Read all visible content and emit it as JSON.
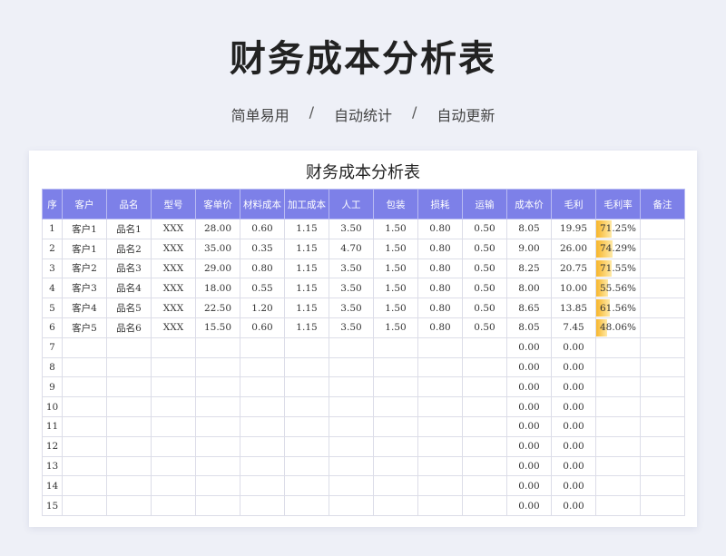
{
  "page": {
    "title": "财务成本分析表",
    "subtitle": [
      "简单易用",
      "自动统计",
      "自动更新"
    ],
    "separator": "/"
  },
  "sheet": {
    "title": "财务成本分析表",
    "header_color": "#7d80e8",
    "bar_color": "#f7b62b",
    "columns": [
      "序",
      "客户",
      "品名",
      "型号",
      "客单价",
      "材料成本",
      "加工成本",
      "人工",
      "包装",
      "损耗",
      "运输",
      "成本价",
      "毛利",
      "毛利率",
      "备注"
    ],
    "rows": [
      {
        "no": "1",
        "customer": "客户1",
        "product": "品名1",
        "model": "XXX",
        "price": "28.00",
        "material": "0.60",
        "processing": "1.15",
        "labor": "3.50",
        "packaging": "1.50",
        "loss": "0.80",
        "transport": "0.50",
        "cost": "8.05",
        "profit": "19.95",
        "rate": "71.25%",
        "rate_value": 0.7125,
        "note": ""
      },
      {
        "no": "2",
        "customer": "客户1",
        "product": "品名2",
        "model": "XXX",
        "price": "35.00",
        "material": "0.35",
        "processing": "1.15",
        "labor": "4.70",
        "packaging": "1.50",
        "loss": "0.80",
        "transport": "0.50",
        "cost": "9.00",
        "profit": "26.00",
        "rate": "74.29%",
        "rate_value": 0.7429,
        "note": ""
      },
      {
        "no": "3",
        "customer": "客户2",
        "product": "品名3",
        "model": "XXX",
        "price": "29.00",
        "material": "0.80",
        "processing": "1.15",
        "labor": "3.50",
        "packaging": "1.50",
        "loss": "0.80",
        "transport": "0.50",
        "cost": "8.25",
        "profit": "20.75",
        "rate": "71.55%",
        "rate_value": 0.7155,
        "note": ""
      },
      {
        "no": "4",
        "customer": "客户3",
        "product": "品名4",
        "model": "XXX",
        "price": "18.00",
        "material": "0.55",
        "processing": "1.15",
        "labor": "3.50",
        "packaging": "1.50",
        "loss": "0.80",
        "transport": "0.50",
        "cost": "8.00",
        "profit": "10.00",
        "rate": "55.56%",
        "rate_value": 0.5556,
        "note": ""
      },
      {
        "no": "5",
        "customer": "客户4",
        "product": "品名5",
        "model": "XXX",
        "price": "22.50",
        "material": "1.20",
        "processing": "1.15",
        "labor": "3.50",
        "packaging": "1.50",
        "loss": "0.80",
        "transport": "0.50",
        "cost": "8.65",
        "profit": "13.85",
        "rate": "61.56%",
        "rate_value": 0.6156,
        "note": ""
      },
      {
        "no": "6",
        "customer": "客户5",
        "product": "品名6",
        "model": "XXX",
        "price": "15.50",
        "material": "0.60",
        "processing": "1.15",
        "labor": "3.50",
        "packaging": "1.50",
        "loss": "0.80",
        "transport": "0.50",
        "cost": "8.05",
        "profit": "7.45",
        "rate": "48.06%",
        "rate_value": 0.4806,
        "note": ""
      },
      {
        "no": "7",
        "customer": "",
        "product": "",
        "model": "",
        "price": "",
        "material": "",
        "processing": "",
        "labor": "",
        "packaging": "",
        "loss": "",
        "transport": "",
        "cost": "0.00",
        "profit": "0.00",
        "rate": "",
        "rate_value": 0,
        "note": ""
      },
      {
        "no": "8",
        "customer": "",
        "product": "",
        "model": "",
        "price": "",
        "material": "",
        "processing": "",
        "labor": "",
        "packaging": "",
        "loss": "",
        "transport": "",
        "cost": "0.00",
        "profit": "0.00",
        "rate": "",
        "rate_value": 0,
        "note": ""
      },
      {
        "no": "9",
        "customer": "",
        "product": "",
        "model": "",
        "price": "",
        "material": "",
        "processing": "",
        "labor": "",
        "packaging": "",
        "loss": "",
        "transport": "",
        "cost": "0.00",
        "profit": "0.00",
        "rate": "",
        "rate_value": 0,
        "note": ""
      },
      {
        "no": "10",
        "customer": "",
        "product": "",
        "model": "",
        "price": "",
        "material": "",
        "processing": "",
        "labor": "",
        "packaging": "",
        "loss": "",
        "transport": "",
        "cost": "0.00",
        "profit": "0.00",
        "rate": "",
        "rate_value": 0,
        "note": ""
      },
      {
        "no": "11",
        "customer": "",
        "product": "",
        "model": "",
        "price": "",
        "material": "",
        "processing": "",
        "labor": "",
        "packaging": "",
        "loss": "",
        "transport": "",
        "cost": "0.00",
        "profit": "0.00",
        "rate": "",
        "rate_value": 0,
        "note": ""
      },
      {
        "no": "12",
        "customer": "",
        "product": "",
        "model": "",
        "price": "",
        "material": "",
        "processing": "",
        "labor": "",
        "packaging": "",
        "loss": "",
        "transport": "",
        "cost": "0.00",
        "profit": "0.00",
        "rate": "",
        "rate_value": 0,
        "note": ""
      },
      {
        "no": "13",
        "customer": "",
        "product": "",
        "model": "",
        "price": "",
        "material": "",
        "processing": "",
        "labor": "",
        "packaging": "",
        "loss": "",
        "transport": "",
        "cost": "0.00",
        "profit": "0.00",
        "rate": "",
        "rate_value": 0,
        "note": ""
      },
      {
        "no": "14",
        "customer": "",
        "product": "",
        "model": "",
        "price": "",
        "material": "",
        "processing": "",
        "labor": "",
        "packaging": "",
        "loss": "",
        "transport": "",
        "cost": "0.00",
        "profit": "0.00",
        "rate": "",
        "rate_value": 0,
        "note": ""
      },
      {
        "no": "15",
        "customer": "",
        "product": "",
        "model": "",
        "price": "",
        "material": "",
        "processing": "",
        "labor": "",
        "packaging": "",
        "loss": "",
        "transport": "",
        "cost": "0.00",
        "profit": "0.00",
        "rate": "",
        "rate_value": 0,
        "note": ""
      }
    ]
  }
}
